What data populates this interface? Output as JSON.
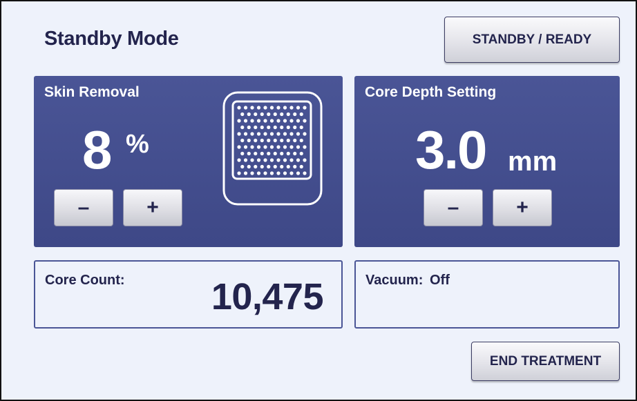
{
  "header": {
    "title": "Standby Mode",
    "standby_button_label": "STANDBY / READY"
  },
  "skin_removal": {
    "label": "Skin Removal",
    "value": "8",
    "unit": "%",
    "decrement_label": "–",
    "increment_label": "+"
  },
  "core_depth": {
    "label": "Core Depth Setting",
    "value": "3.0",
    "unit": "mm",
    "decrement_label": "–",
    "increment_label": "+"
  },
  "core_count": {
    "label": "Core Count:",
    "value": "10,475"
  },
  "vacuum": {
    "label": "Vacuum:",
    "status": "Off"
  },
  "footer": {
    "end_button_label": "END TREATMENT"
  },
  "colors": {
    "panel": "#4a5596",
    "text_dark": "#23244d",
    "background": "#eef2fb"
  }
}
